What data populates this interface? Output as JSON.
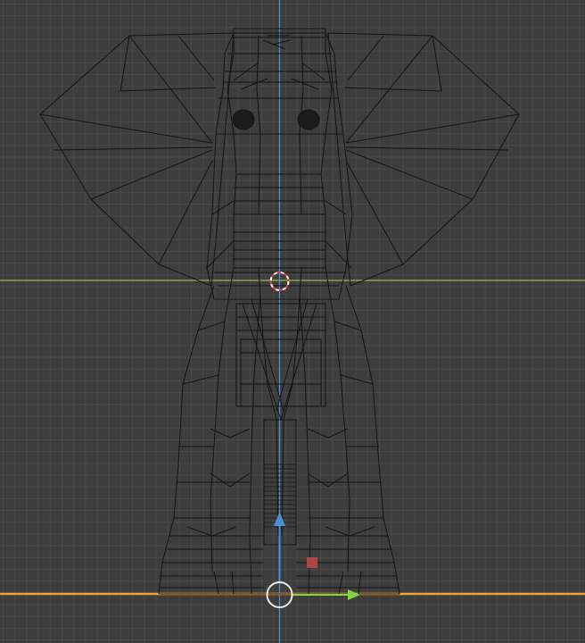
{
  "viewport": {
    "view": "front-orthographic",
    "mode": "wireframe",
    "grid": true
  },
  "scene": {
    "object": "elephant mesh",
    "selected_object_color": "#141414"
  },
  "axes": {
    "x_axis_color": "#f0a23b",
    "y_axis_color": "#9bb84a",
    "z_axis_color": "#4d8ed8"
  },
  "gizmo": {
    "z_arrow_color": "#4d8ed8",
    "x_arrow_color": "#8ad33a",
    "center_handle_color": "#e8e8e8",
    "plane_handle_color": "#c24a4a"
  },
  "cursor_3d": {
    "ring_colors": [
      "#e04040",
      "#ffffff"
    ]
  }
}
